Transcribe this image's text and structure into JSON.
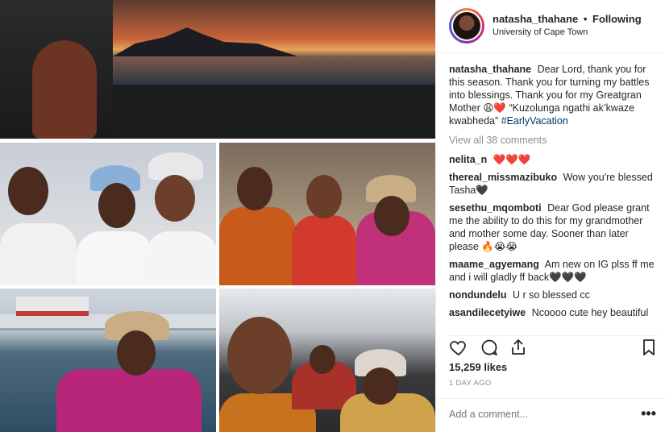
{
  "post": {
    "username": "natasha_thahane",
    "separator": "•",
    "following_label": "Following",
    "location": "University of Cape Town"
  },
  "caption": {
    "username": "natasha_thahane",
    "text": "Dear Lord, thank you for this season. Thank you for turning my battles into blessings. Thank you for my Greatgran Mother 😩❤️ “Kuzolunga ngathi ak’kwaze kwabheda”",
    "hashtag": "#EarlyVacation"
  },
  "view_all_label": "View all 38 comments",
  "comments": [
    {
      "user": "nelita_n",
      "text": "❤️❤️❤️"
    },
    {
      "user": "thereal_missmazibuko",
      "text": "Wow you're blessed Tasha🖤"
    },
    {
      "user": "sesethu_mqomboti",
      "text": "Dear God please grant me the ability to do this for my grandmother and mother some day. Sooner than later please 🔥😭😭"
    },
    {
      "user": "maame_agyemang",
      "text": "Am new on IG plss ff me and i will gladly ff back🖤🖤🖤"
    },
    {
      "user": "nondundelu",
      "text": "U r so blessed cc"
    },
    {
      "user": "asandilecetyiwe",
      "text": "Ncoooo cute hey beautiful"
    }
  ],
  "likes_label": "15,259 likes",
  "time_label": "1 DAY AGO",
  "add_comment_placeholder": "Add a comment...",
  "more_label": "•••",
  "icons": {
    "like": "heart-outline-icon",
    "comment": "comment-bubble-icon",
    "share": "share-icon",
    "save": "bookmark-icon"
  }
}
